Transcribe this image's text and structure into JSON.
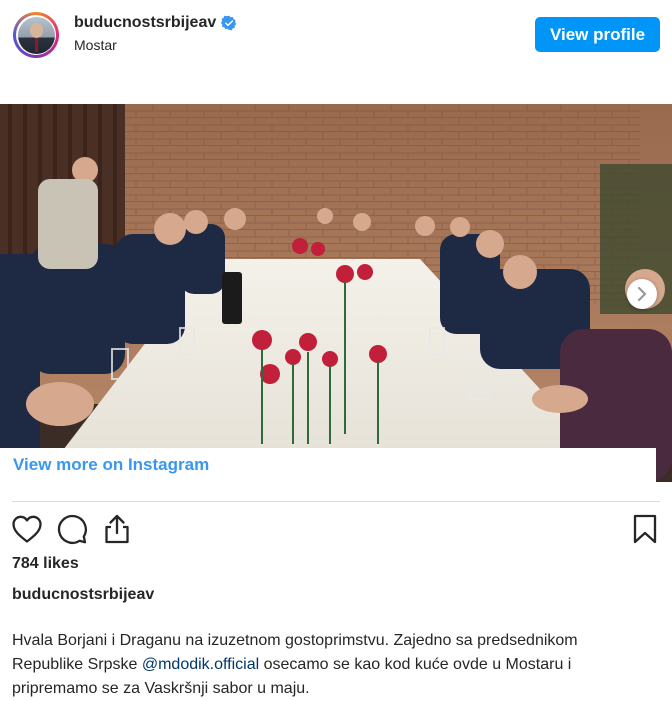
{
  "header": {
    "username": "buducnostsrbijeav",
    "location": "Mostar",
    "view_profile_label": "View profile",
    "verified_icon": "verified-badge-icon",
    "accent": "#0095f6"
  },
  "media": {
    "view_more_label": "View more on Instagram",
    "next_icon": "chevron-right-icon"
  },
  "actions": {
    "like_icon": "heart-icon",
    "comment_icon": "comment-icon",
    "share_icon": "share-icon",
    "save_icon": "bookmark-icon"
  },
  "post": {
    "likes": "784 likes",
    "caption_user": "buducnostsrbijeav",
    "caption_line1": "Hvala Borjani i Draganu na izuzetnom gostoprimstvu. Zajedno sa predsednikom",
    "caption_line2_pre": "Republike Srpske ",
    "caption_mention": "@mdodik.official",
    "caption_line2_post": " osecamo se kao kod kuće ovde u Mostaru i",
    "caption_line3": "pripremamo se za Vaskršnji sabor u maju."
  }
}
